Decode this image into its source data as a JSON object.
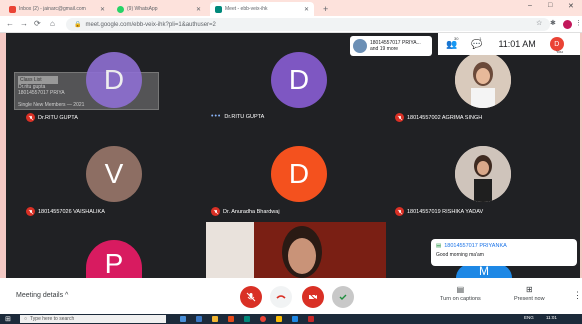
{
  "browser": {
    "tabs": [
      {
        "label": "Inbox (2) - jainarc@gmail.com",
        "favicon_color": "#ea4335",
        "active": false
      },
      {
        "label": "(9) WhatsApp",
        "favicon_color": "#25d366",
        "active": false
      },
      {
        "label": "Meet - ebb-veix-ihk",
        "favicon_color": "#00897b",
        "active": true
      }
    ],
    "new_tab": "+",
    "url": "meet.google.com/ebb-veix-ihk?pli=1&authuser=2",
    "window_controls": {
      "minimize": "–",
      "maximize": "□",
      "close": "✕"
    }
  },
  "meeting": {
    "caption_box": {
      "title": "Class List",
      "lines": [
        "Dr.ritu gupta",
        "18014557017 PRIYA",
        "Single New Members — 2021"
      ]
    },
    "participants": [
      {
        "name": "Dr.RITU GUPTA",
        "initial": "D",
        "avatar_color": "#7e57c2",
        "muted": true,
        "photo": false
      },
      {
        "name": "Dr.RITU GUPTA",
        "initial": "D",
        "avatar_color": "#7e57c2",
        "muted": false,
        "speaking": true,
        "photo": false
      },
      {
        "name": "18014557002 AGRIMA SINGH",
        "initial": "",
        "avatar_color": "#e8d9cf",
        "muted": true,
        "photo": true
      },
      {
        "name": "18014557026 VAISHALIKA",
        "initial": "V",
        "avatar_color": "#8d6e63",
        "muted": true,
        "photo": false
      },
      {
        "name": "Dr. Anuradha Bhardwaj",
        "initial": "D",
        "avatar_color": "#f4511e",
        "muted": true,
        "photo": false
      },
      {
        "name": "18014557019 RISHIKA YADAV",
        "initial": "",
        "avatar_color": "#d7ccc8",
        "muted": true,
        "photo": true
      },
      {
        "name": "",
        "initial": "P",
        "avatar_color": "#d81b60",
        "muted": false,
        "photo": false
      },
      {
        "name": "",
        "initial": "M",
        "avatar_color": "#1e88e5",
        "muted": false,
        "photo": false
      }
    ],
    "presenting_chip": {
      "name": "18014557017 PRIYA...",
      "more": "and 19 more"
    },
    "people_count": "30",
    "chat_count": "1",
    "clock": "11:01 AM",
    "self": {
      "initial": "D",
      "label": "You"
    },
    "chat_toast": {
      "sender": "18014557017 PRIYANKA",
      "message": "Good morning ma'am"
    }
  },
  "controls": {
    "meeting_details": "Meeting details",
    "captions": "Turn on captions",
    "present": "Present now",
    "more": "⋮"
  },
  "taskbar": {
    "search_placeholder": "Type here to search",
    "lang": "ENG",
    "time": "11:01"
  },
  "colors": {
    "mute_red": "#d93025",
    "meet_bg": "#202124",
    "accent_blue": "#1a73e8"
  }
}
